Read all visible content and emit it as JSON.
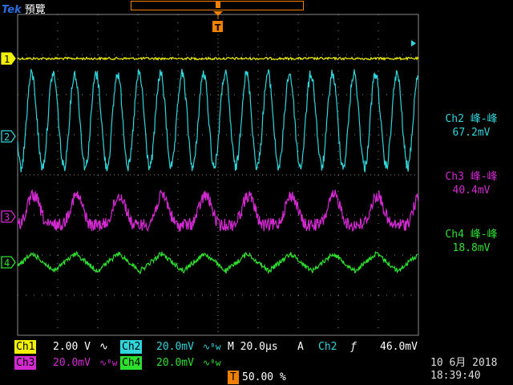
{
  "header": {
    "brand": "Tek",
    "mode": "預覽",
    "trigger_marker": "T"
  },
  "colors": {
    "ch1": "#f2f200",
    "ch2": "#2fd6dc",
    "ch3": "#d22ad0",
    "ch4": "#2ee02e",
    "trigger": "#f08000",
    "grid": "#8a8a8a"
  },
  "channels": [
    {
      "marker": "1"
    },
    {
      "marker": "2"
    },
    {
      "marker": "3"
    },
    {
      "marker": "4"
    }
  ],
  "measurements": [
    {
      "title": "Ch2 峰-峰",
      "value": "67.2mV"
    },
    {
      "title": "Ch3 峰-峰",
      "value": "40.4mV"
    },
    {
      "title": "Ch4 峰-峰",
      "value": "18.8mV"
    }
  ],
  "status": {
    "ch1_name": "Ch1",
    "ch1_scale": "2.00 V",
    "ch1_coupling": "∿",
    "ch2_name": "Ch2",
    "ch2_scale": "20.0mV",
    "ch2_coupling": "∿ᴮw",
    "timebase": "M 20.0µs",
    "acq_mode": "A",
    "trig_source": "Ch2",
    "trig_slope": "ƒ",
    "trig_level": "46.0mV",
    "ch3_name": "Ch3",
    "ch3_scale": "20.0mV",
    "ch3_coupling": "∿ᴮw",
    "ch4_name": "Ch4",
    "ch4_scale": "20.0mV",
    "ch4_coupling": "∿ᴮw",
    "trig_pos_icon": "T",
    "trig_pos": "50.00 %"
  },
  "clock": {
    "date": "10 6月  2018",
    "time": "18:39:40"
  }
}
